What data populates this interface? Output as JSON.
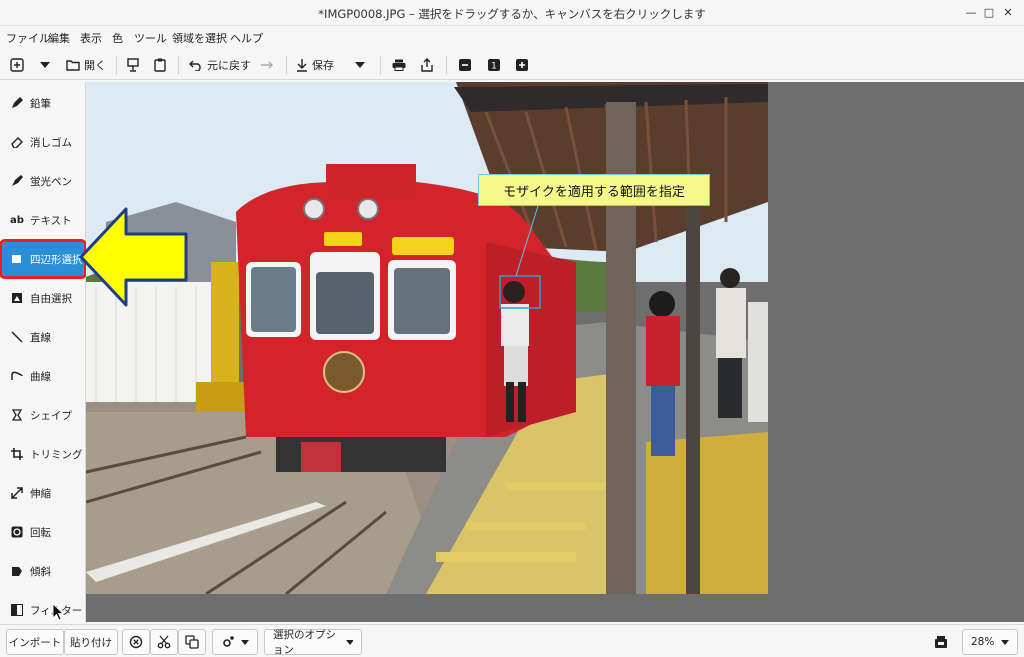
{
  "window": {
    "title": "*IMGP0008.JPG – 選択をドラッグするか、キャンバスを右クリックします"
  },
  "menu": [
    "ファイル",
    "編集",
    "表示",
    "色",
    "ツール",
    "領域を選択",
    "ヘルプ"
  ],
  "toolbar": {
    "open_label": "開く",
    "undo_label": "元に戻す",
    "save_label": "保存",
    "zoom_value": "1"
  },
  "tools": [
    {
      "label": "鉛筆",
      "icon": "pencil-icon"
    },
    {
      "label": "消しゴム",
      "icon": "eraser-icon"
    },
    {
      "label": "蛍光ペン",
      "icon": "highlighter-icon"
    },
    {
      "label": "テキスト",
      "icon": "text-icon"
    },
    {
      "label": "四辺形選択",
      "icon": "rect-select-icon"
    },
    {
      "label": "自由選択",
      "icon": "free-select-icon"
    },
    {
      "label": "直線",
      "icon": "line-icon"
    },
    {
      "label": "曲線",
      "icon": "curve-icon"
    },
    {
      "label": "シェイプ",
      "icon": "shape-icon"
    },
    {
      "label": "トリミング",
      "icon": "crop-icon"
    },
    {
      "label": "伸縮",
      "icon": "scale-icon"
    },
    {
      "label": "回転",
      "icon": "rotate-icon"
    },
    {
      "label": "傾斜",
      "icon": "skew-icon"
    },
    {
      "label": "フィルター",
      "icon": "filter-icon"
    }
  ],
  "active_tool": "四辺形選択",
  "canvas": {
    "callout": "モザイクを適用する範囲を指定"
  },
  "bottom": {
    "import_label": "インポート",
    "paste_label": "貼り付け",
    "selection_options_label": "選択のオプション",
    "zoom_label": "28%"
  },
  "colors": {
    "accent": "#2a8fd6",
    "highlight_outline": "#e82020",
    "arrow_fill": "#ffff00",
    "callout_fill": "#f4f98a"
  }
}
